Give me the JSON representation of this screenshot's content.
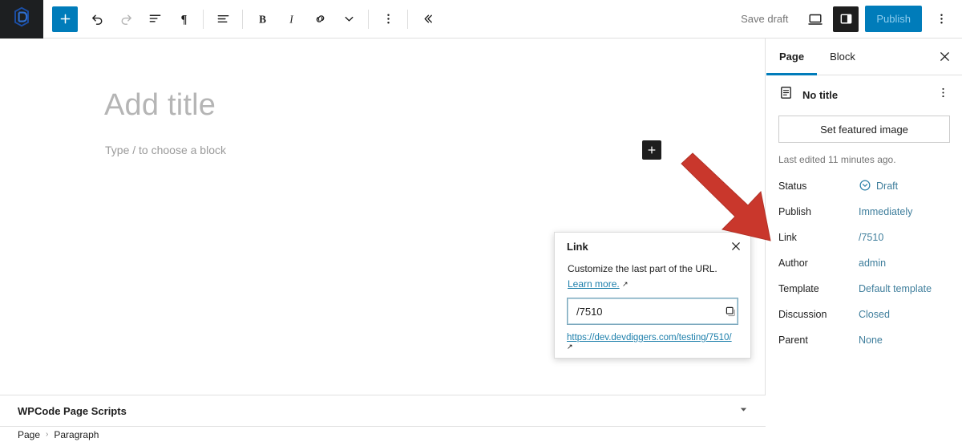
{
  "toolbar": {
    "logo_icon": "devdiggers-logo-icon",
    "add_block_label": "+",
    "items": [
      {
        "name": "undo-button",
        "icon": "undo-icon"
      },
      {
        "name": "redo-button",
        "icon": "redo-icon"
      },
      {
        "name": "list-view-button",
        "icon": "list-view-icon"
      },
      {
        "name": "paragraph-block-button",
        "icon": "paragraph-icon"
      },
      {
        "name": "align-button",
        "icon": "align-left-icon"
      },
      {
        "name": "bold-button",
        "icon": "bold-icon"
      },
      {
        "name": "italic-button",
        "icon": "italic-icon"
      },
      {
        "name": "link-button",
        "icon": "link-icon"
      },
      {
        "name": "more-formatting-button",
        "icon": "chevron-down-icon"
      },
      {
        "name": "block-options-button",
        "icon": "kebab-menu-icon"
      },
      {
        "name": "collapse-toolbar-button",
        "icon": "double-chevron-left-icon"
      }
    ],
    "save_draft_label": "Save draft",
    "preview_icon": "desktop-preview-icon",
    "sidebar_toggle_icon": "settings-sidebar-icon",
    "publish_label": "Publish",
    "options_icon": "kebab-menu-icon",
    "accent_color": "#007cba"
  },
  "canvas": {
    "title_placeholder": "Add title",
    "paragraph_placeholder": "Type / to choose a block",
    "inserter_label": "+"
  },
  "wpcode": {
    "panel_title": "WPCode Page Scripts",
    "toggle_icon": "chevron-down-icon"
  },
  "breadcrumb": {
    "items": [
      "Page",
      "Paragraph"
    ],
    "separator": "›"
  },
  "sidebar": {
    "tabs": [
      {
        "label": "Page",
        "active": true
      },
      {
        "label": "Block",
        "active": false
      }
    ],
    "close_icon": "close-icon",
    "document": {
      "icon": "page-document-icon",
      "title": "No title",
      "more_icon": "kebab-menu-icon"
    },
    "featured_image_label": "Set featured image",
    "last_edited": "Last edited 11 minutes ago.",
    "meta": [
      {
        "label": "Status",
        "value": "Draft",
        "icon": "status-draft-icon"
      },
      {
        "label": "Publish",
        "value": "Immediately",
        "icon": ""
      },
      {
        "label": "Link",
        "value": "/7510",
        "icon": ""
      },
      {
        "label": "Author",
        "value": "admin",
        "icon": ""
      },
      {
        "label": "Template",
        "value": "Default template",
        "icon": ""
      },
      {
        "label": "Discussion",
        "value": "Closed",
        "icon": ""
      },
      {
        "label": "Parent",
        "value": "None",
        "icon": ""
      }
    ],
    "link_color": "#3f7e9c"
  },
  "link_popover": {
    "title": "Link",
    "close_icon": "close-icon",
    "description": "Customize the last part of the URL.",
    "learn_more_label": "Learn more.",
    "learn_more_icon": "external-link-icon",
    "input_value": "/7510",
    "copy_icon": "copy-icon",
    "permalink": "https://dev.devdiggers.com/testing/7510/",
    "permalink_icon": "external-link-icon"
  },
  "annotation": {
    "arrow_name": "red-arrow-annotation",
    "color": "#c9372c",
    "points_to": "Link"
  }
}
